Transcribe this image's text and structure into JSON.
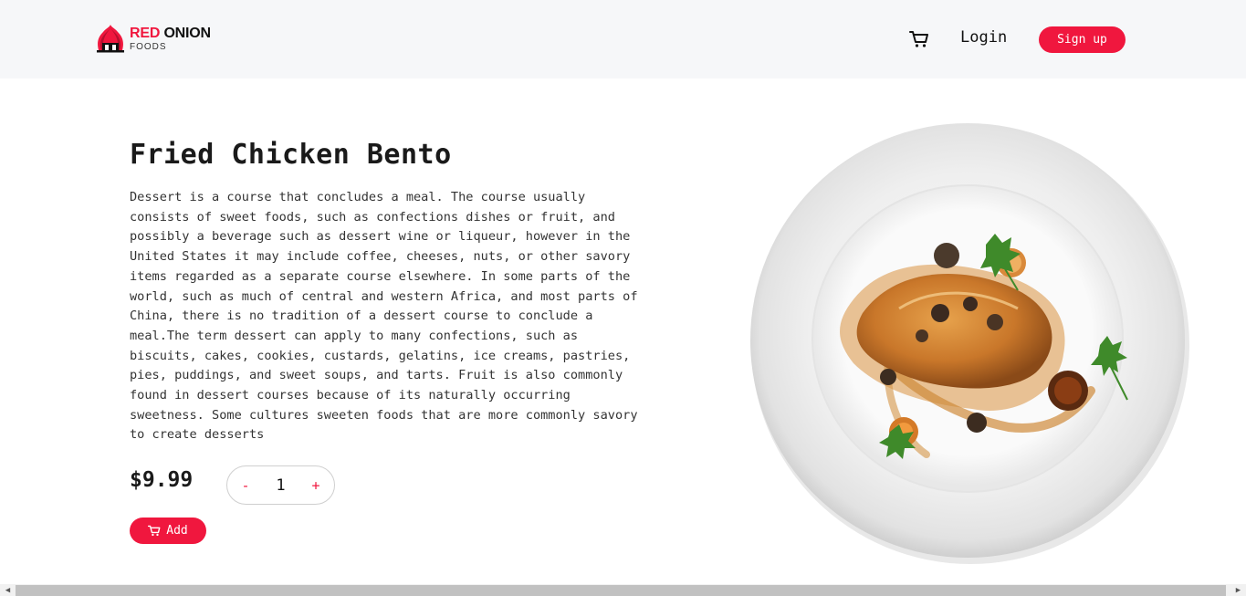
{
  "header": {
    "brand_main": "RED ",
    "brand_accent": "ONION",
    "brand_sub": "FOODS",
    "login_label": "Login",
    "signup_label": "Sign up"
  },
  "product": {
    "title": "Fried Chicken Bento",
    "description": "Dessert is a course that concludes a meal. The course usually consists of sweet foods, such as confections dishes or fruit, and possibly a beverage such as dessert wine or liqueur, however in the United States it may include coffee, cheeses, nuts, or other savory items regarded as a separate course elsewhere. In some parts of the world, such as much of central and western Africa, and most parts of China, there is no tradition of a dessert course to conclude a meal.The term dessert can apply to many confections, such as biscuits, cakes, cookies, custards, gelatins, ice creams, pastries, pies, puddings, and sweet soups, and tarts. Fruit is also commonly found in dessert courses because of its naturally occurring sweetness. Some cultures sweeten foods that are more commonly savory to create desserts",
    "price": "$9.99",
    "quantity": "1",
    "decrement_label": "-",
    "increment_label": "+",
    "add_label": "Add"
  },
  "colors": {
    "accent": "#f0173e",
    "header_bg": "#f6f7f9"
  },
  "icons": {
    "logo": "onion-logo-icon",
    "cart": "cart-icon",
    "add_cart": "cart-icon"
  }
}
